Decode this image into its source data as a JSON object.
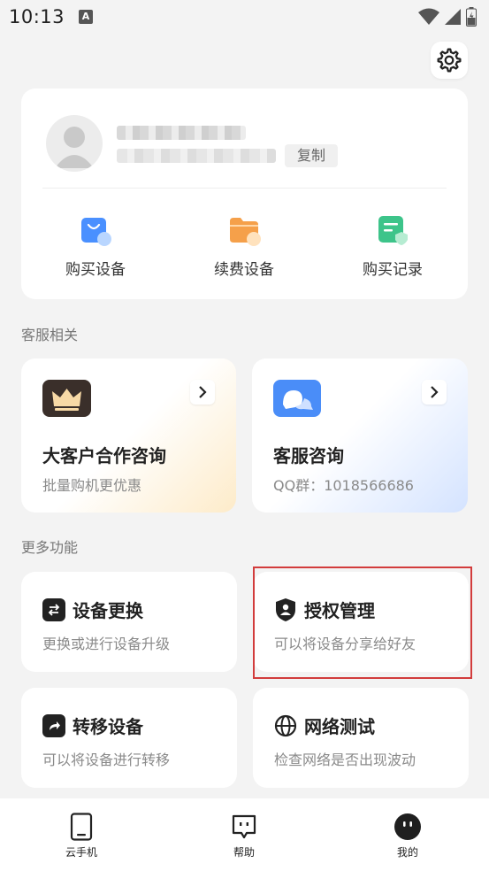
{
  "status_bar": {
    "time": "10:13",
    "notification_glyph": "A"
  },
  "profile": {
    "copy_label": "复制",
    "quick_actions": [
      {
        "label": "购买设备",
        "icon": "shopping-bag-icon",
        "color": "#3d8bff"
      },
      {
        "label": "续费设备",
        "icon": "folder-renew-icon",
        "color": "#f5a04a"
      },
      {
        "label": "购买记录",
        "icon": "record-list-icon",
        "color": "#3dc48a"
      }
    ]
  },
  "service_section": {
    "title": "客服相关",
    "enterprise": {
      "title": "大客户合作咨询",
      "subtitle": "批量购机更优惠"
    },
    "support": {
      "title": "客服咨询",
      "subtitle": "QQ群：1018566686"
    }
  },
  "more_section": {
    "title": "更多功能",
    "items": [
      {
        "title": "设备更换",
        "subtitle": "更换或进行设备升级",
        "icon": "swap-icon"
      },
      {
        "title": "授权管理",
        "subtitle": "可以将设备分享给好友",
        "icon": "shield-user-icon"
      },
      {
        "title": "转移设备",
        "subtitle": "可以将设备进行转移",
        "icon": "share-arrow-icon"
      },
      {
        "title": "网络测试",
        "subtitle": "检查网络是否出现波动",
        "icon": "globe-icon"
      }
    ]
  },
  "tabbar": {
    "tabs": [
      {
        "label": "云手机",
        "icon": "phone-icon"
      },
      {
        "label": "帮助",
        "icon": "chat-help-icon"
      },
      {
        "label": "我的",
        "icon": "profile-face-icon",
        "active": true
      }
    ]
  }
}
